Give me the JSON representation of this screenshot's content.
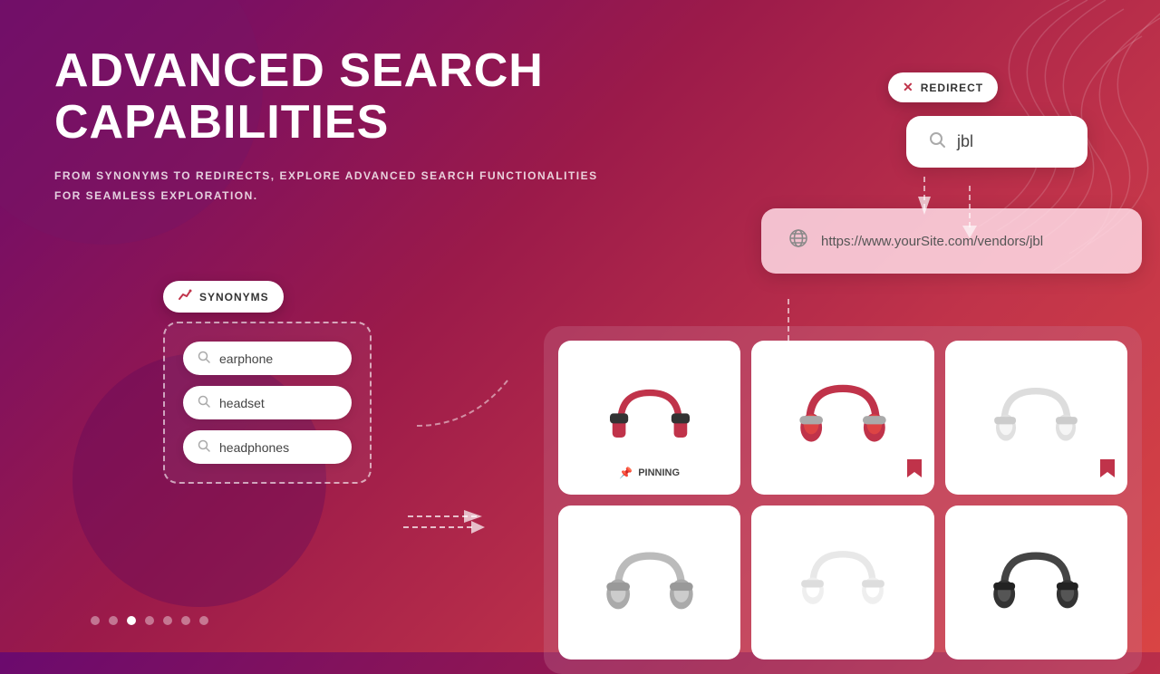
{
  "page": {
    "title": "Advanced Search Capabilities",
    "subtitle_line1": "FROM SYNONYMS TO REDIRECTS, EXPLORE ADVANCED SEARCH FUNCTIONALITIES",
    "subtitle_line2": "FOR SEAMLESS EXPLORATION."
  },
  "synonyms": {
    "badge_label": "SYNONYMS",
    "items": [
      {
        "id": 1,
        "text": "earphone"
      },
      {
        "id": 2,
        "text": "headset"
      },
      {
        "id": 3,
        "text": "headphones"
      }
    ]
  },
  "redirect": {
    "badge_label": "REDIRECT",
    "search_value": "jbl",
    "url": "https://www.yourSite.com/vendors/jbl"
  },
  "pinning": {
    "label": "PINNING"
  },
  "pagination": {
    "total": 7,
    "active": 3
  },
  "icons": {
    "search": "🔍",
    "redirect_x": "✕",
    "synonyms_chart": "📈",
    "globe": "🌐",
    "pin": "📌",
    "bookmark": "🔖"
  }
}
